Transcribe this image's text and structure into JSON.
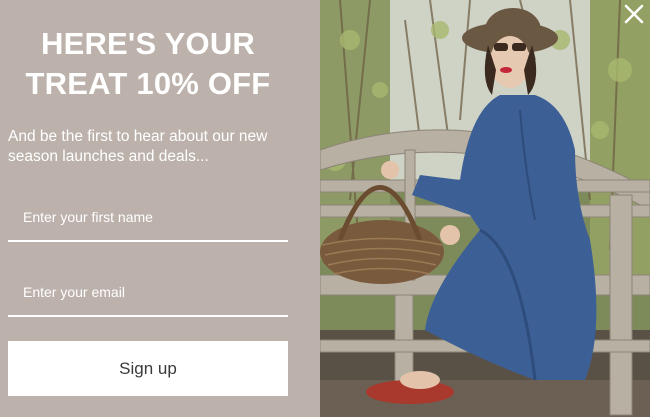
{
  "popup": {
    "headline_line1": "HERE'S YOUR",
    "headline_line2": "TREAT 10% OFF",
    "subtext": "And be the first to hear about our new season launches and deals...",
    "first_name_placeholder": "Enter your first name",
    "first_name_value": "",
    "email_placeholder": "Enter your email",
    "email_value": "",
    "signup_label": "Sign up"
  },
  "colors": {
    "panel_bg": "#bcb2ab",
    "button_bg": "#ffffff",
    "button_text": "#3a3a3a",
    "text": "#ffffff"
  },
  "icons": {
    "close": "close-icon"
  }
}
